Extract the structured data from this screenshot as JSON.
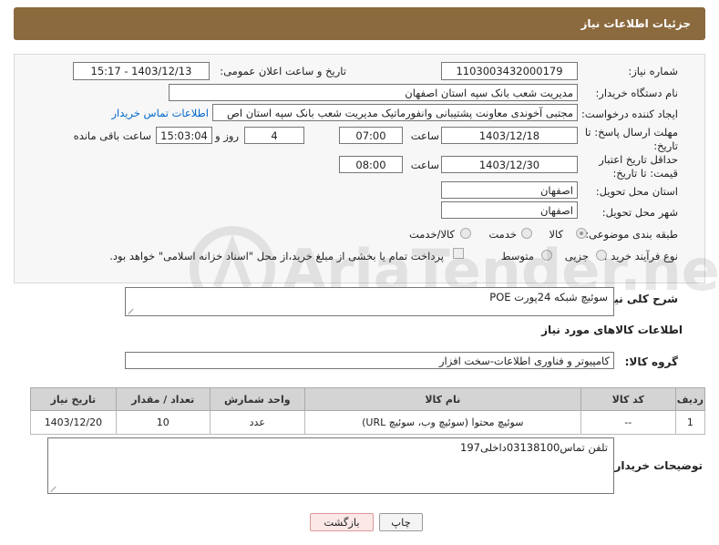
{
  "header": {
    "title": "جزئیات اطلاعات نیاز"
  },
  "form": {
    "need_number": {
      "label": "شماره نیاز:",
      "value": "1103003432000179"
    },
    "announce_datetime": {
      "label": "تاریخ و ساعت اعلان عمومی:",
      "value": "1403/12/13 - 15:17"
    },
    "buyer_org": {
      "label": "نام دستگاه خریدار:",
      "value": "مدیریت شعب بانک سپه استان اصفهان"
    },
    "requester": {
      "label": "ایجاد کننده درخواست:",
      "value": "مجتبی آخوندی معاونت پشتیبانی وانفورماتیک مدیریت شعب بانک سپه استان اص",
      "link": "اطلاعات تماس خریدار"
    },
    "reply_deadline": {
      "label": "مهلت ارسال پاسخ: تا تاریخ:",
      "date": "1403/12/18",
      "time_label": "ساعت",
      "time": "07:00",
      "days": "4",
      "days_label": "روز و",
      "remaining": "15:03:04",
      "remaining_label": "ساعت باقی مانده"
    },
    "price_validity": {
      "label": "حداقل تاریخ اعتبار قیمت: تا تاریخ:",
      "date": "1403/12/30",
      "time_label": "ساعت",
      "time": "08:00"
    },
    "province": {
      "label": "استان محل تحویل:",
      "value": "اصفهان"
    },
    "city": {
      "label": "شهر محل تحویل:",
      "value": "اصفهان"
    },
    "category": {
      "label": "طبقه بندی موضوعی:",
      "options": [
        "کالا",
        "خدمت",
        "کالا/خدمت"
      ]
    },
    "process": {
      "label": "نوع فرآیند خرید :",
      "options": [
        "جزیی",
        "متوسط"
      ],
      "payment_note": "پرداخت تمام یا بخشی از مبلغ خرید،از محل \"اسناد خزانه اسلامی\" خواهد بود."
    }
  },
  "description": {
    "label": "شرح کلی نیاز:",
    "value": "سوئیچ شبکه 24پورت POE"
  },
  "goods_section": {
    "title": "اطلاعات کالاهای مورد نیاز",
    "group_label": "گروه کالا:",
    "group_value": "کامپیوتر و فناوری اطلاعات-سخت افزار"
  },
  "table": {
    "headers": [
      "ردیف",
      "کد کالا",
      "نام کالا",
      "واحد شمارش",
      "تعداد / مقدار",
      "تاریخ نیاز"
    ],
    "rows": [
      [
        "1",
        "--",
        "سوئیچ محتوا (سوئیچ وب، سوئیچ URL)",
        "عدد",
        "10",
        "1403/12/20"
      ]
    ]
  },
  "buyer_notes": {
    "label": "توضیحات خریدار:",
    "value": "تلفن تماس03138100داخلی197"
  },
  "buttons": {
    "print": "چاپ",
    "back": "بازگشت"
  },
  "watermark": {
    "text": "AriaTender.neT"
  }
}
